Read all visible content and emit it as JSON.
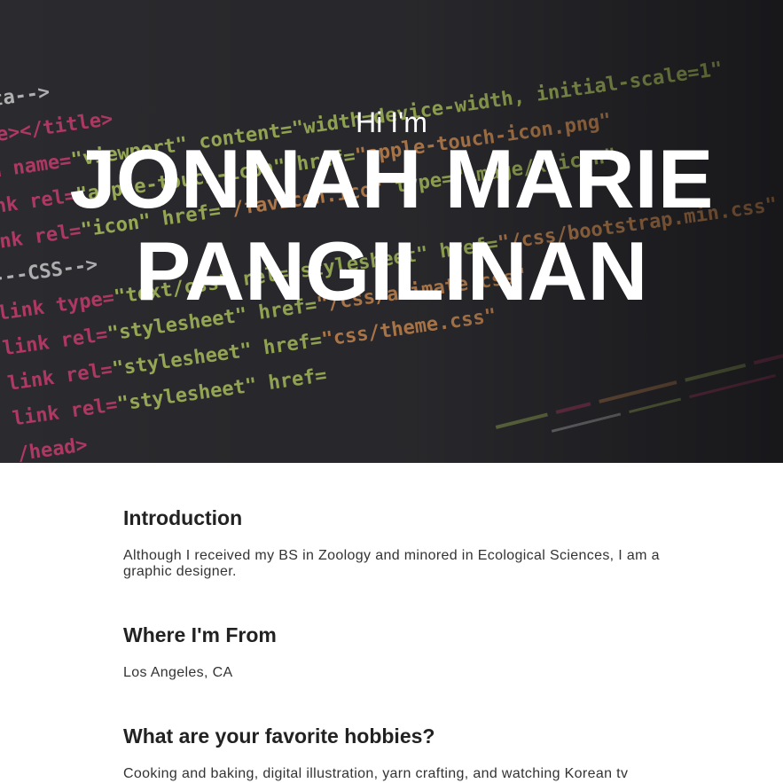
{
  "hero": {
    "greeting": "Hi I'm",
    "name_line1": "JONNAH MARIE",
    "name_line2": "PANGILINAN"
  },
  "sections": [
    {
      "title": "Introduction",
      "body": "Although I received my BS in Zoology and minored in Ecological Sciences, I am a graphic designer."
    },
    {
      "title": "Where I'm From",
      "body": "Los Angeles, CA"
    },
    {
      "title": "What are your favorite hobbies?",
      "body": "Cooking and baking, digital illustration, yarn crafting, and watching Korean tv"
    }
  ],
  "colors": {
    "hero_background": "#2e2e30",
    "code_pink": "#e8437a",
    "code_green": "#c9e36a",
    "code_orange": "#f2a35c",
    "code_white": "#e8e8e8",
    "text_dark": "#222222"
  }
}
